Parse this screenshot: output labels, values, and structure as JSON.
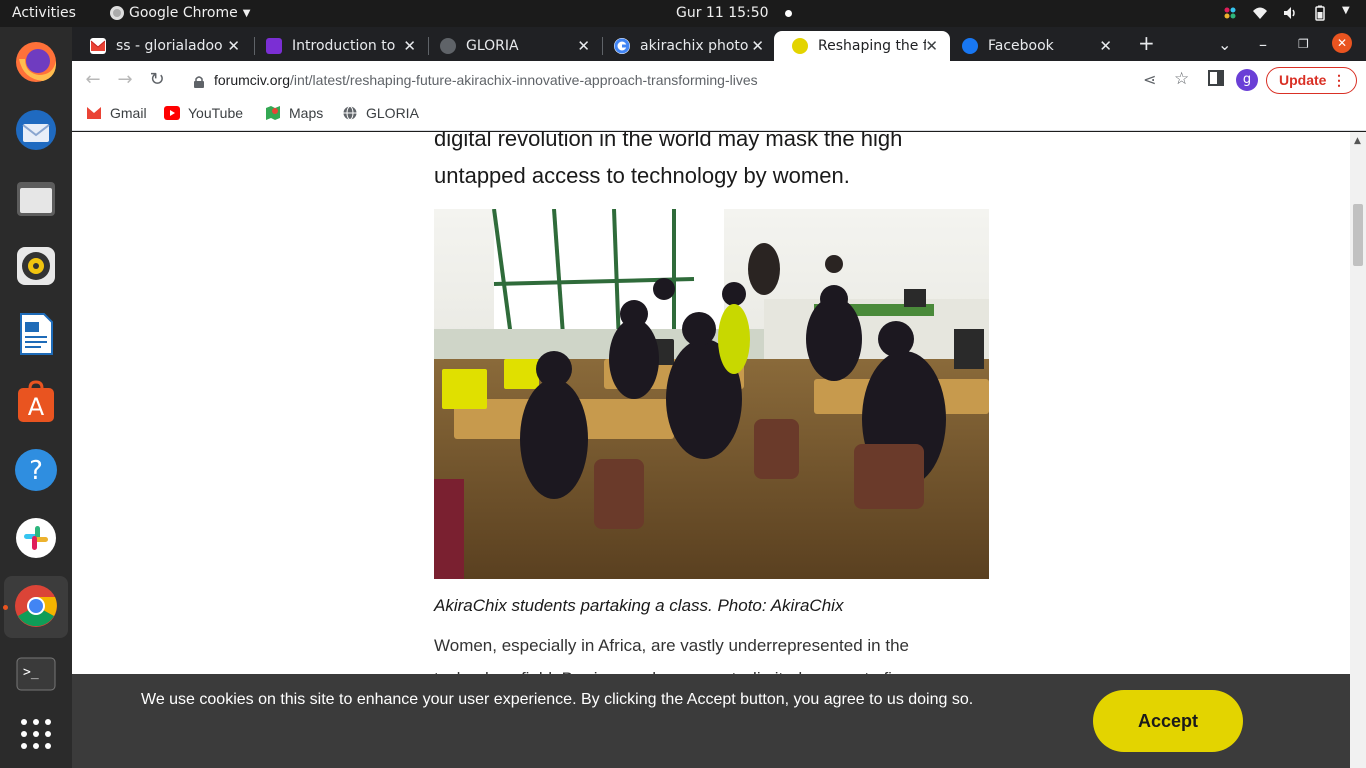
{
  "topbar": {
    "activities": "Activities",
    "app_name": "Google Chrome",
    "clock": "Gur 11  15:50"
  },
  "dock": {
    "items": [
      "firefox",
      "thunderbird",
      "files",
      "rhythmbox",
      "libreoffice-writer",
      "app-center",
      "help",
      "slack",
      "chrome",
      "terminal",
      "show-apps"
    ]
  },
  "tabs": [
    {
      "label": "ss - glorialadoo",
      "favicon": "gmail"
    },
    {
      "label": "Introduction to",
      "favicon": "course"
    },
    {
      "label": "GLORIA",
      "favicon": "globe"
    },
    {
      "label": "akirachix photo",
      "favicon": "google"
    },
    {
      "label": "Reshaping the fu",
      "favicon": "forumciv",
      "active": true
    },
    {
      "label": "Facebook",
      "favicon": "facebook"
    }
  ],
  "toolbar": {
    "url_domain": "forumciv.org",
    "url_path": "/int/latest/reshaping-future-akirachix-innovative-approach-transforming-lives",
    "profile_initial": "g",
    "update_label": "Update"
  },
  "bookmarks": [
    {
      "label": "Gmail",
      "icon": "gmail"
    },
    {
      "label": "YouTube",
      "icon": "youtube"
    },
    {
      "label": "Maps",
      "icon": "maps"
    },
    {
      "label": "GLORIA",
      "icon": "globe"
    }
  ],
  "article": {
    "lead_line1": "digital revolution in the world may mask the high",
    "lead_line2": "untapped access to technology by women.",
    "caption": "AkiraChix students partaking a class. Photo: AkiraChix",
    "body_line1": "Women, especially in Africa, are vastly underrepresented in the",
    "body_line2": "technology field. Barriers such as poverty, limited access to finance"
  },
  "cookie": {
    "message": "We use cookies on this site to enhance your user experience. By clicking the Accept button, you agree to us doing so.",
    "accept_label": "Accept"
  },
  "colors": {
    "accept": "#e3d400",
    "update": "#d93025",
    "chrome_dark": "#202124"
  }
}
